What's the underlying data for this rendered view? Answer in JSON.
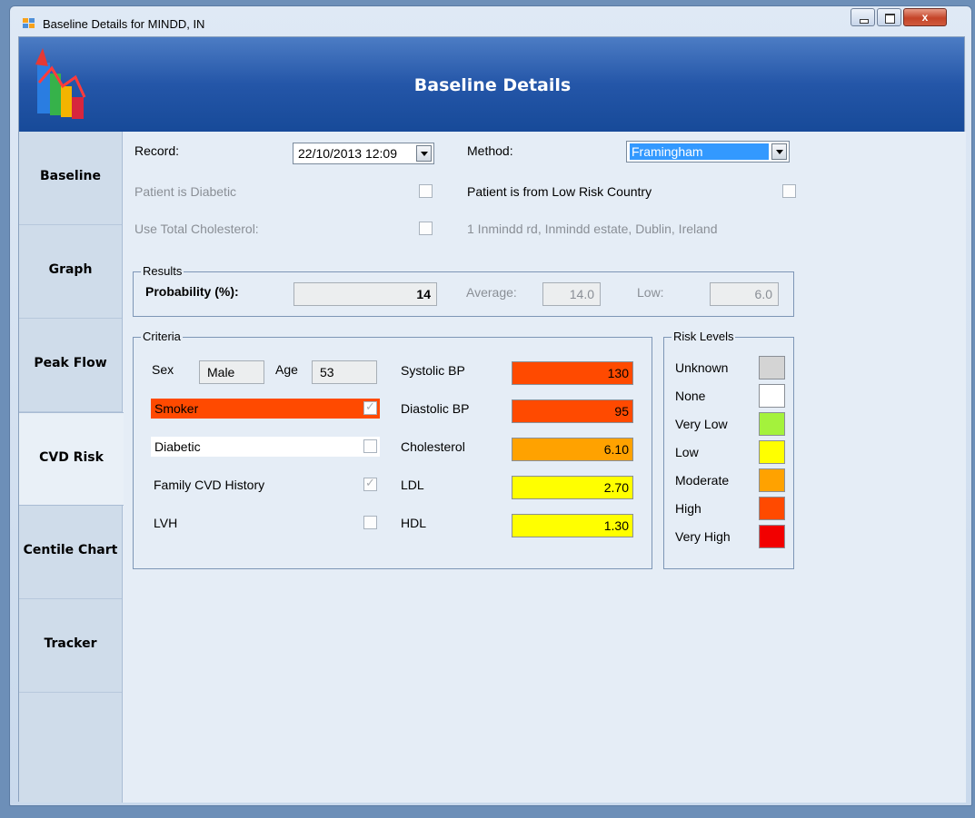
{
  "window": {
    "title": "Baseline Details for MINDD, IN",
    "close_label": "x"
  },
  "banner": {
    "title": "Baseline Details"
  },
  "tabs": [
    {
      "label": "Baseline"
    },
    {
      "label": "Graph"
    },
    {
      "label": "Peak Flow"
    },
    {
      "label": "CVD Risk"
    },
    {
      "label": "Centile Chart"
    },
    {
      "label": "Tracker"
    }
  ],
  "active_tab": "CVD Risk",
  "form": {
    "record_label": "Record:",
    "record_value": "22/10/2013 12:09",
    "method_label": "Method:",
    "method_value": "Framingham",
    "diabetic_label": "Patient is Diabetic",
    "diabetic_checked": false,
    "low_risk_label": "Patient is from Low Risk Country",
    "low_risk_checked": false,
    "total_chol_label": "Use Total Cholesterol:",
    "total_chol_checked": false,
    "address": "1 Inmindd rd, Inmindd estate, Dublin, Ireland"
  },
  "results": {
    "group_title": "Results",
    "probability_label": "Probability (%):",
    "probability_value": "14",
    "average_label": "Average:",
    "average_value": "14.0",
    "low_label": "Low:",
    "low_value": "6.0"
  },
  "criteria": {
    "group_title": "Criteria",
    "sex_label": "Sex",
    "sex_value": "Male",
    "age_label": "Age",
    "age_value": "53",
    "smoker_label": "Smoker",
    "smoker_checked": true,
    "diabetic_label": "Diabetic",
    "diabetic_checked": false,
    "family_label": "Family CVD History",
    "family_checked": true,
    "lvh_label": "LVH",
    "lvh_checked": false,
    "systolic_label": "Systolic BP",
    "systolic_value": "130",
    "diastolic_label": "Diastolic BP",
    "diastolic_value": "95",
    "cholesterol_label": "Cholesterol",
    "cholesterol_value": "6.10",
    "ldl_label": "LDL",
    "ldl_value": "2.70",
    "hdl_label": "HDL",
    "hdl_value": "1.30"
  },
  "risk_levels": {
    "group_title": "Risk Levels",
    "items": [
      {
        "label": "Unknown",
        "color": "#d4d4d4"
      },
      {
        "label": "None",
        "color": "#ffffff"
      },
      {
        "label": "Very Low",
        "color": "#a4f23c"
      },
      {
        "label": "Low",
        "color": "#ffff00"
      },
      {
        "label": "Moderate",
        "color": "#ffa200"
      },
      {
        "label": "High",
        "color": "#ff4a00"
      },
      {
        "label": "Very High",
        "color": "#f20000"
      }
    ]
  },
  "colors": {
    "smoker_row": "#ff4a00",
    "systolic": "#ff4a00",
    "diastolic": "#ff4a00",
    "cholesterol": "#ffa200",
    "ldl": "#ffff00",
    "hdl": "#ffff00"
  }
}
